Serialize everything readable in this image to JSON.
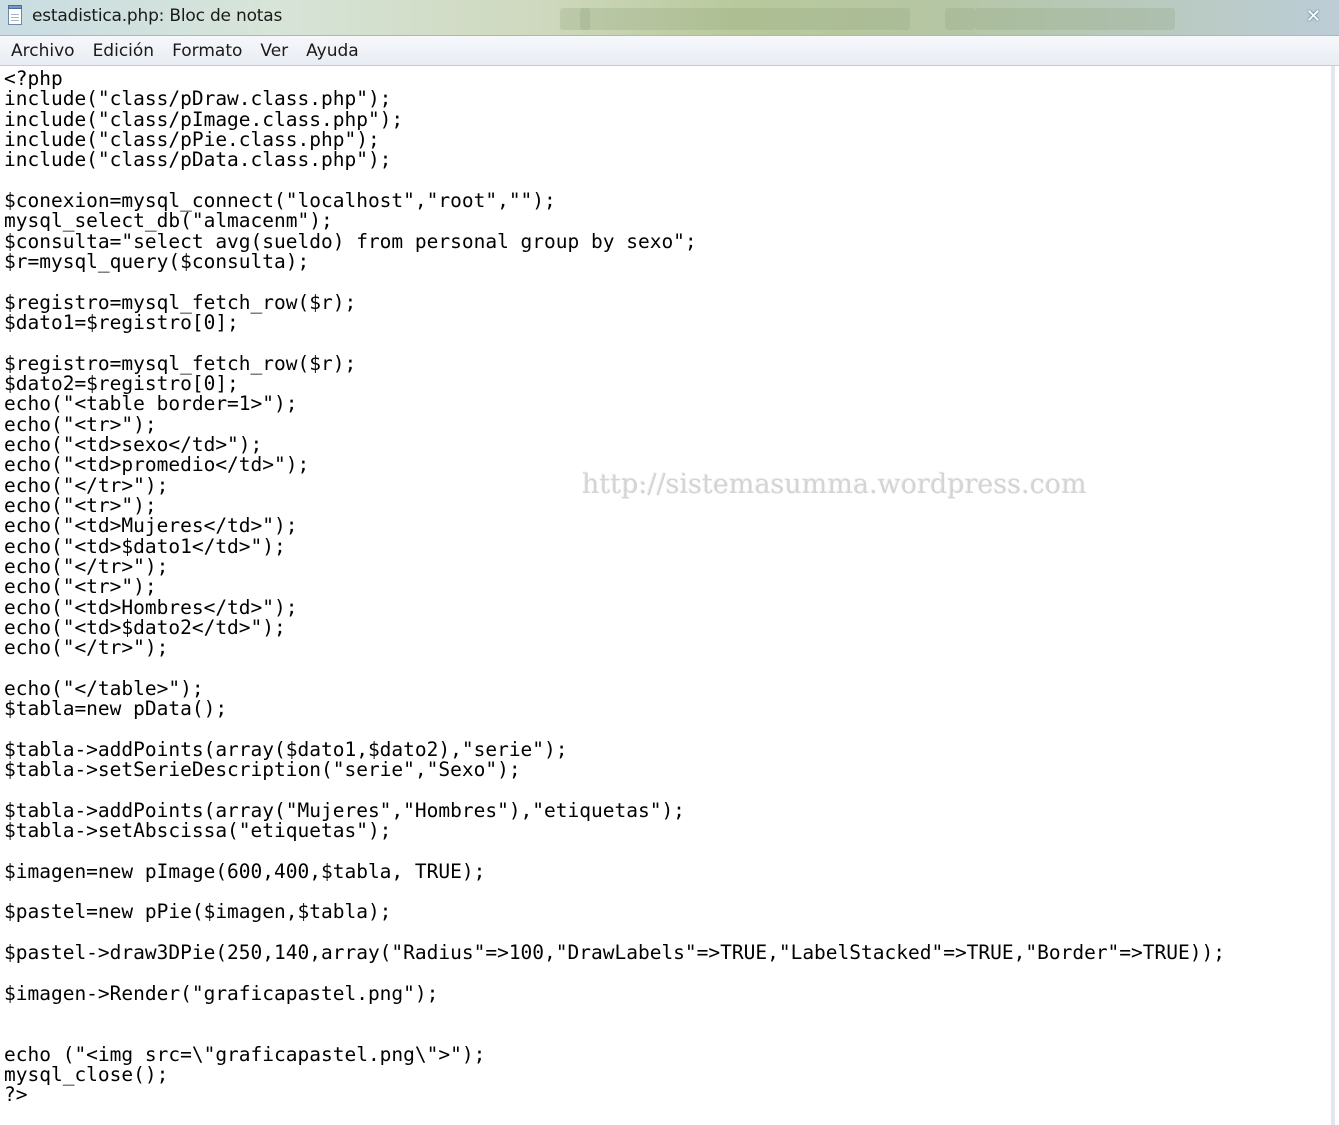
{
  "window": {
    "title": "estadistica.php: Bloc de notas"
  },
  "menu": {
    "items": [
      "Archivo",
      "Edición",
      "Formato",
      "Ver",
      "Ayuda"
    ]
  },
  "editor": {
    "lines": [
      "<?php",
      "include(\"class/pDraw.class.php\");",
      "include(\"class/pImage.class.php\");",
      "include(\"class/pPie.class.php\");",
      "include(\"class/pData.class.php\");",
      "",
      "$conexion=mysql_connect(\"localhost\",\"root\",\"\");",
      "mysql_select_db(\"almacenm\");",
      "$consulta=\"select avg(sueldo) from personal group by sexo\";",
      "$r=mysql_query($consulta);",
      "",
      "$registro=mysql_fetch_row($r);",
      "$dato1=$registro[0];",
      "",
      "$registro=mysql_fetch_row($r);",
      "$dato2=$registro[0];",
      "echo(\"<table border=1>\");",
      "echo(\"<tr>\");",
      "echo(\"<td>sexo</td>\");",
      "echo(\"<td>promedio</td>\");",
      "echo(\"</tr>\");",
      "echo(\"<tr>\");",
      "echo(\"<td>Mujeres</td>\");",
      "echo(\"<td>$dato1</td>\");",
      "echo(\"</tr>\");",
      "echo(\"<tr>\");",
      "echo(\"<td>Hombres</td>\");",
      "echo(\"<td>$dato2</td>\");",
      "echo(\"</tr>\");",
      "",
      "echo(\"</table>\");",
      "$tabla=new pData();",
      "",
      "$tabla->addPoints(array($dato1,$dato2),\"serie\");",
      "$tabla->setSerieDescription(\"serie\",\"Sexo\");",
      "",
      "$tabla->addPoints(array(\"Mujeres\",\"Hombres\"),\"etiquetas\");",
      "$tabla->setAbscissa(\"etiquetas\");",
      "",
      "$imagen=new pImage(600,400,$tabla, TRUE);",
      "",
      "$pastel=new pPie($imagen,$tabla);",
      "",
      "$pastel->draw3DPie(250,140,array(\"Radius\"=>100,\"DrawLabels\"=>TRUE,\"LabelStacked\"=>TRUE,\"Border\"=>TRUE));",
      "",
      "$imagen->Render(\"graficapastel.png\");",
      "",
      "",
      "echo (\"<img src=\\\"graficapastel.png\\\">\");",
      "mysql_close();",
      "?>"
    ]
  },
  "watermark": {
    "text": "http://sistemasumma.wordpress.com"
  }
}
